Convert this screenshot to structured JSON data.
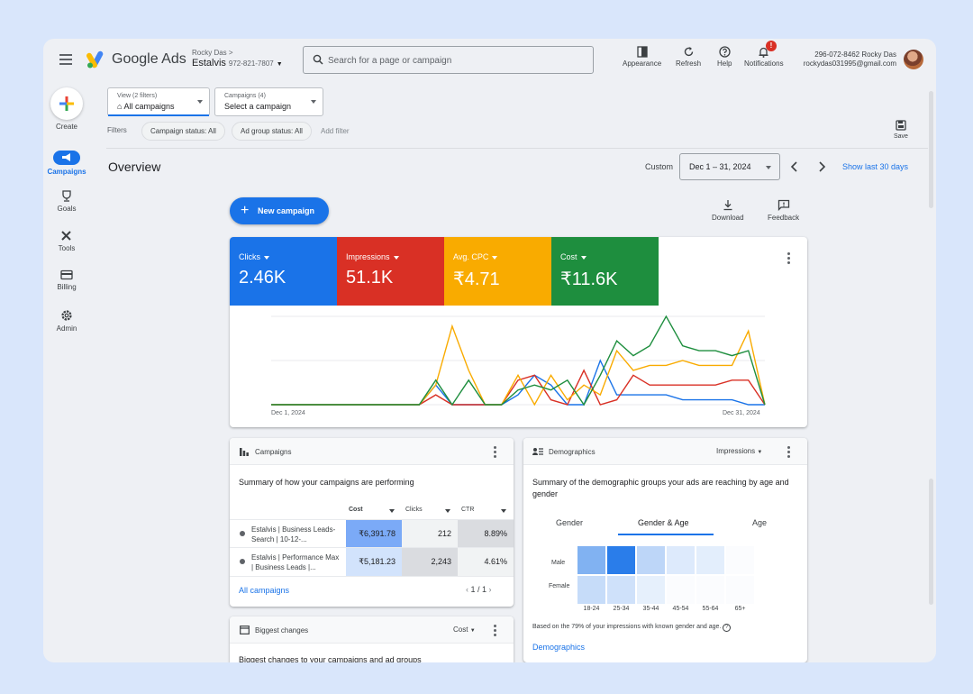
{
  "header": {
    "brand": "Google Ads",
    "owner": "Rocky Das",
    "owner_arrow": ">",
    "account_name": "Estalvis",
    "account_id": "972-821-7807",
    "search_placeholder": "Search for a page or campaign",
    "tools": [
      {
        "label": "Appearance",
        "icon": "appearance-icon"
      },
      {
        "label": "Refresh",
        "icon": "refresh-icon"
      },
      {
        "label": "Help",
        "icon": "help-icon"
      },
      {
        "label": "Notifications",
        "icon": "bell-icon",
        "badge": "!"
      }
    ],
    "user_line1": "296-072-8462 Rocky Das",
    "user_email": "rockydas031995@gmail.com"
  },
  "sidebar": {
    "create_label": "Create",
    "items": [
      {
        "label": "Campaigns",
        "icon": "megaphone-icon",
        "active": true
      },
      {
        "label": "Goals",
        "icon": "trophy-icon"
      },
      {
        "label": "Tools",
        "icon": "tools-icon"
      },
      {
        "label": "Billing",
        "icon": "card-icon"
      },
      {
        "label": "Admin",
        "icon": "gear-icon"
      }
    ]
  },
  "filters": {
    "view_small": "View (2 filters)",
    "view_value": "All campaigns",
    "campaigns_small": "Campaigns (4)",
    "campaigns_value": "Select a campaign",
    "label": "Filters",
    "chips": [
      "Campaign status: All",
      "Ad group status: All"
    ],
    "add_filter": "Add filter",
    "save_label": "Save"
  },
  "overview": {
    "title": "Overview",
    "custom_label": "Custom",
    "date_range": "Dec 1 – 31, 2024",
    "show_last": "Show last 30 days",
    "new_campaign": "New campaign",
    "download": "Download",
    "feedback": "Feedback"
  },
  "metrics": [
    {
      "label": "Clicks",
      "value": "2.46K",
      "color": "#1a73e8"
    },
    {
      "label": "Impressions",
      "value": "51.1K",
      "color": "#d93025"
    },
    {
      "label": "Avg. CPC",
      "value": "₹4.71",
      "color": "#f9ab00"
    },
    {
      "label": "Cost",
      "value": "₹11.6K",
      "color": "#1e8e3e"
    }
  ],
  "chart_data": {
    "type": "line",
    "x_start": "Dec 1, 2024",
    "x_end": "Dec 31, 2024",
    "x": [
      1,
      2,
      3,
      4,
      5,
      6,
      7,
      8,
      9,
      10,
      11,
      12,
      13,
      14,
      15,
      16,
      17,
      18,
      19,
      20,
      21,
      22,
      23,
      24,
      25,
      26,
      27,
      28,
      29,
      30,
      31
    ],
    "grid": true,
    "series": [
      {
        "name": "Clicks",
        "color": "#1a73e8",
        "values": [
          0,
          0,
          0,
          0,
          0,
          0,
          0,
          0,
          0,
          0,
          4,
          0,
          0,
          0,
          0,
          2,
          6,
          4,
          0,
          0,
          9,
          2,
          2,
          2,
          2,
          1,
          1,
          1,
          1,
          0,
          0
        ]
      },
      {
        "name": "Impressions",
        "color": "#d93025",
        "values": [
          0,
          0,
          0,
          0,
          0,
          0,
          0,
          0,
          0,
          0,
          2,
          0,
          0,
          0,
          0,
          5,
          6,
          1,
          0,
          7,
          0,
          1,
          6,
          4,
          4,
          4,
          4,
          4,
          5,
          5,
          0
        ]
      },
      {
        "name": "Avg. CPC",
        "color": "#f9ab00",
        "values": [
          0,
          0,
          0,
          0,
          0,
          0,
          0,
          0,
          0,
          0,
          4,
          16,
          7,
          0,
          0,
          6,
          0,
          6,
          1,
          4,
          2,
          11,
          7,
          8,
          8,
          9,
          8,
          8,
          8,
          15,
          0
        ]
      },
      {
        "name": "Cost",
        "color": "#1e8e3e",
        "values": [
          0,
          0,
          0,
          0,
          0,
          0,
          0,
          0,
          0,
          0,
          5,
          0,
          5,
          0,
          0,
          3,
          4,
          3,
          5,
          0,
          6,
          13,
          10,
          12,
          18,
          12,
          11,
          11,
          10,
          11,
          0
        ]
      }
    ]
  },
  "campaigns_card": {
    "title": "Campaigns",
    "subtitle": "Summary of how your campaigns are performing",
    "columns": [
      "Cost",
      "Clicks",
      "CTR"
    ],
    "rows": [
      {
        "name": "Estalvis | Business Leads-Search | 10-12-...",
        "cost": "₹6,391.78",
        "clicks": "212",
        "ctr": "8.89%"
      },
      {
        "name": "Estalvis | Performance Max | Business Leads |...",
        "cost": "₹5,181.23",
        "clicks": "2,243",
        "ctr": "4.61%"
      }
    ],
    "footer_link": "All campaigns",
    "pager": "1 / 1"
  },
  "demographics_card": {
    "title": "Demographics",
    "metric_selector": "Impressions",
    "subtitle": "Summary of the demographic groups your ads are reaching by age and gender",
    "tabs": [
      "Gender",
      "Gender & Age",
      "Age"
    ],
    "active_tab": "Gender & Age",
    "rows": [
      "Male",
      "Female"
    ],
    "ages": [
      "18-24",
      "25-34",
      "35-44",
      "45-54",
      "55-64",
      "65+"
    ],
    "heat_levels": [
      [
        0.55,
        1.0,
        0.25,
        0.08,
        0.05,
        0
      ],
      [
        0.2,
        0.15,
        0.04,
        0,
        0,
        0
      ]
    ],
    "footnote": "Based on the 79% of your impressions with known gender and age.",
    "footer_link": "Demographics"
  },
  "changes_card": {
    "title": "Biggest changes",
    "selector": "Cost",
    "subtitle": "Biggest changes to your campaigns and ad groups"
  }
}
